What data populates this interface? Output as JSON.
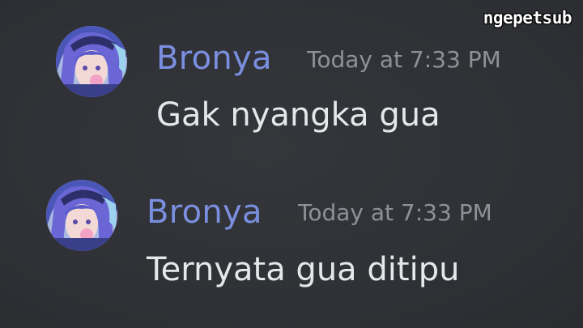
{
  "watermark": "ngepetsub",
  "messages": [
    {
      "author": "Bronya",
      "timestamp": "Today at 7:33 PM",
      "text": "Gak nyangka gua",
      "avatar_icon": "anime-character-avatar"
    },
    {
      "author": "Bronya",
      "timestamp": "Today at 7:33 PM",
      "text": "Ternyata gua ditipu",
      "avatar_icon": "anime-character-avatar"
    }
  ],
  "colors": {
    "background": "#2f3136",
    "username": "#7b8fe0",
    "timestamp": "#8e9297",
    "message_text": "#e6e7e9"
  }
}
